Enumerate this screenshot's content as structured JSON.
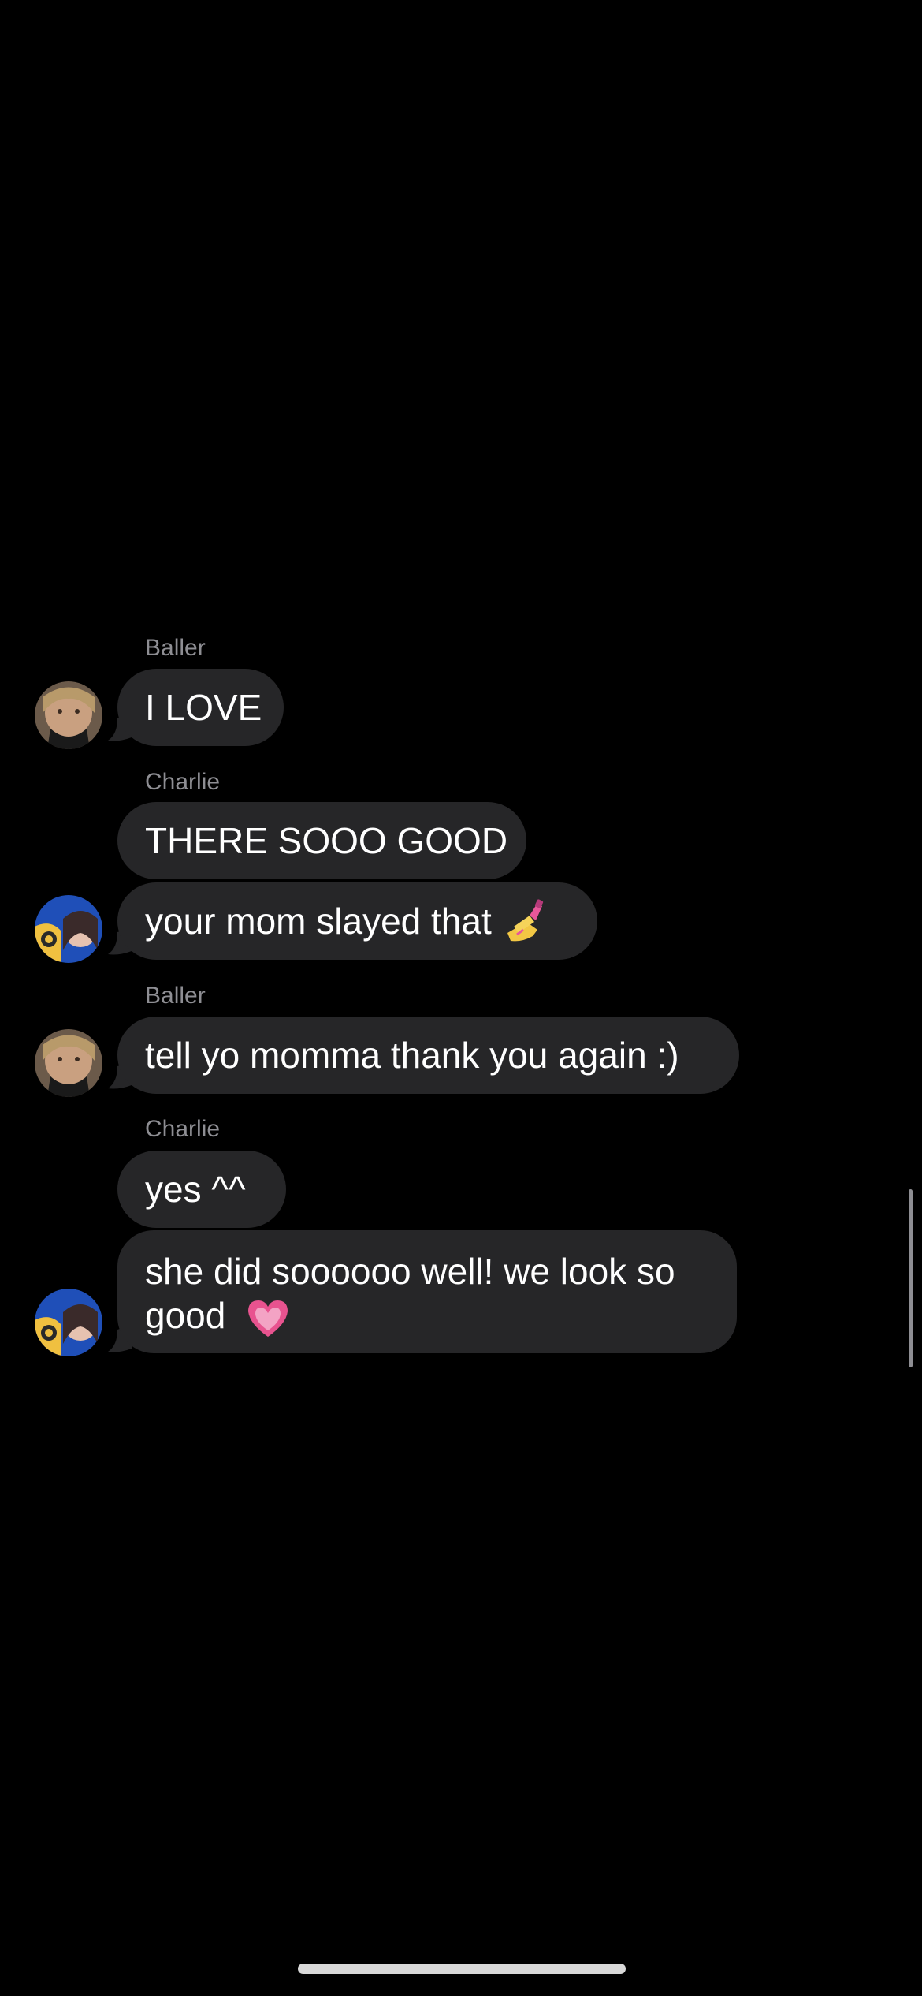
{
  "conversation": {
    "messages": [
      {
        "sender": "Baller",
        "bubbles": [
          {
            "text": "I LOVE"
          }
        ]
      },
      {
        "sender": "Charlie",
        "bubbles": [
          {
            "text": "THERE SOOO GOOD"
          },
          {
            "text": "your mom slayed that",
            "emoji": "nail-polish-emoji"
          }
        ]
      },
      {
        "sender": "Baller",
        "bubbles": [
          {
            "text": "tell yo momma thank you again :)"
          }
        ]
      },
      {
        "sender": "Charlie",
        "bubbles": [
          {
            "text": "yes ^^"
          },
          {
            "text": "she did soooooo well! we look so good",
            "emoji": "pink-heart-emoji"
          }
        ]
      }
    ]
  },
  "colors": {
    "background": "#000000",
    "bubble": "#262628",
    "sender_label": "#8e8e93",
    "text": "#ffffff"
  }
}
